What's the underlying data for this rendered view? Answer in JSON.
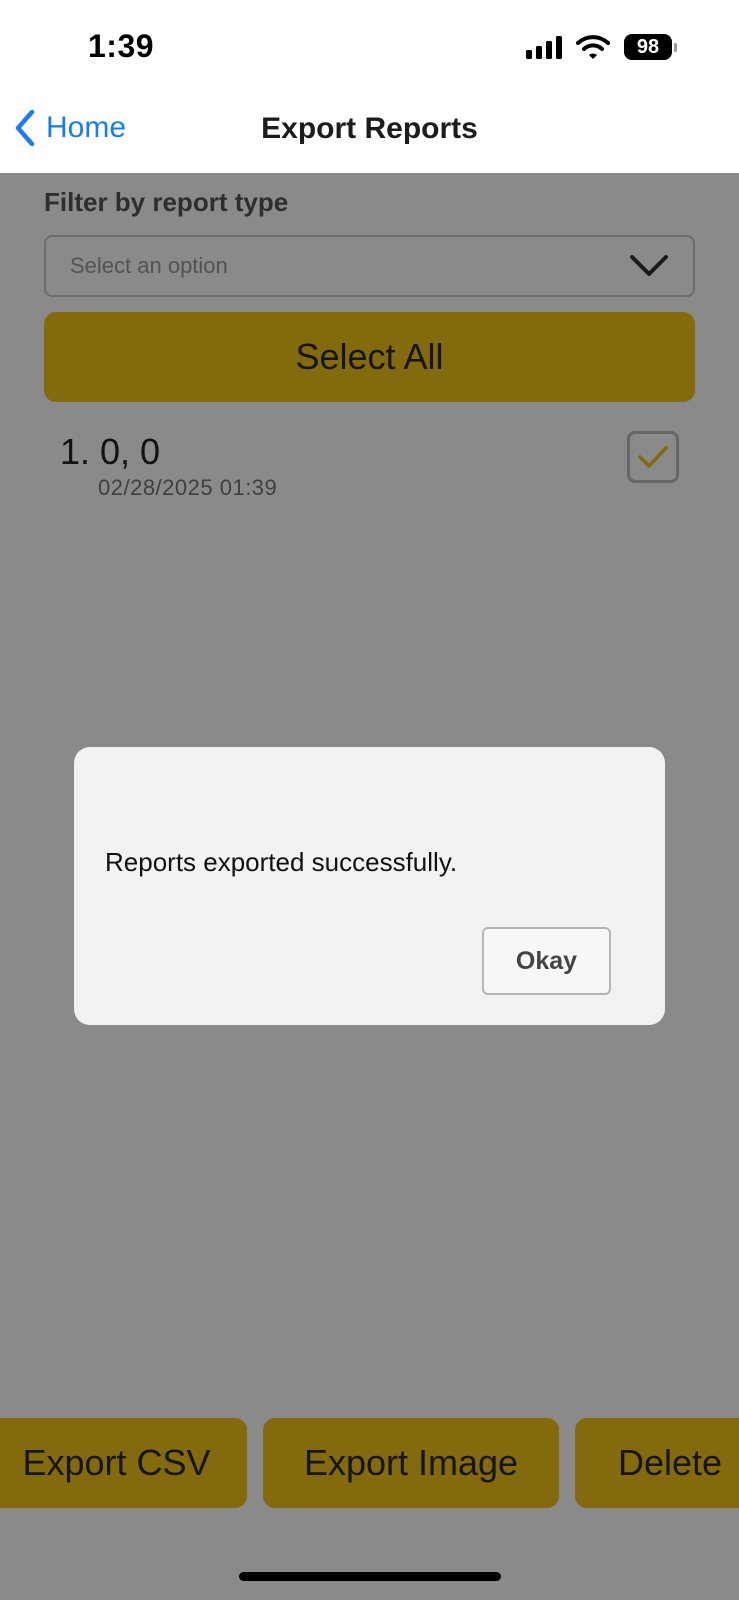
{
  "status_bar": {
    "time": "1:39",
    "battery_level": "98",
    "icons": [
      "signal-icon",
      "wifi-icon",
      "battery-icon"
    ]
  },
  "nav": {
    "back_label": "Home",
    "title": "Export Reports",
    "accent_color": "#1a7cf0"
  },
  "filter": {
    "label": "Filter by report type",
    "placeholder": "Select an option"
  },
  "select_all_label": "Select All",
  "reports": [
    {
      "title": "1. 0, 0",
      "date": "02/28/2025 01:39",
      "checked": true
    }
  ],
  "actions": {
    "export_csv": "Export CSV",
    "export_image": "Export Image",
    "delete": "Delete",
    "button_color": "#f0c419"
  },
  "dialog": {
    "message": "Reports exported successfully.",
    "okay_label": "Okay"
  }
}
